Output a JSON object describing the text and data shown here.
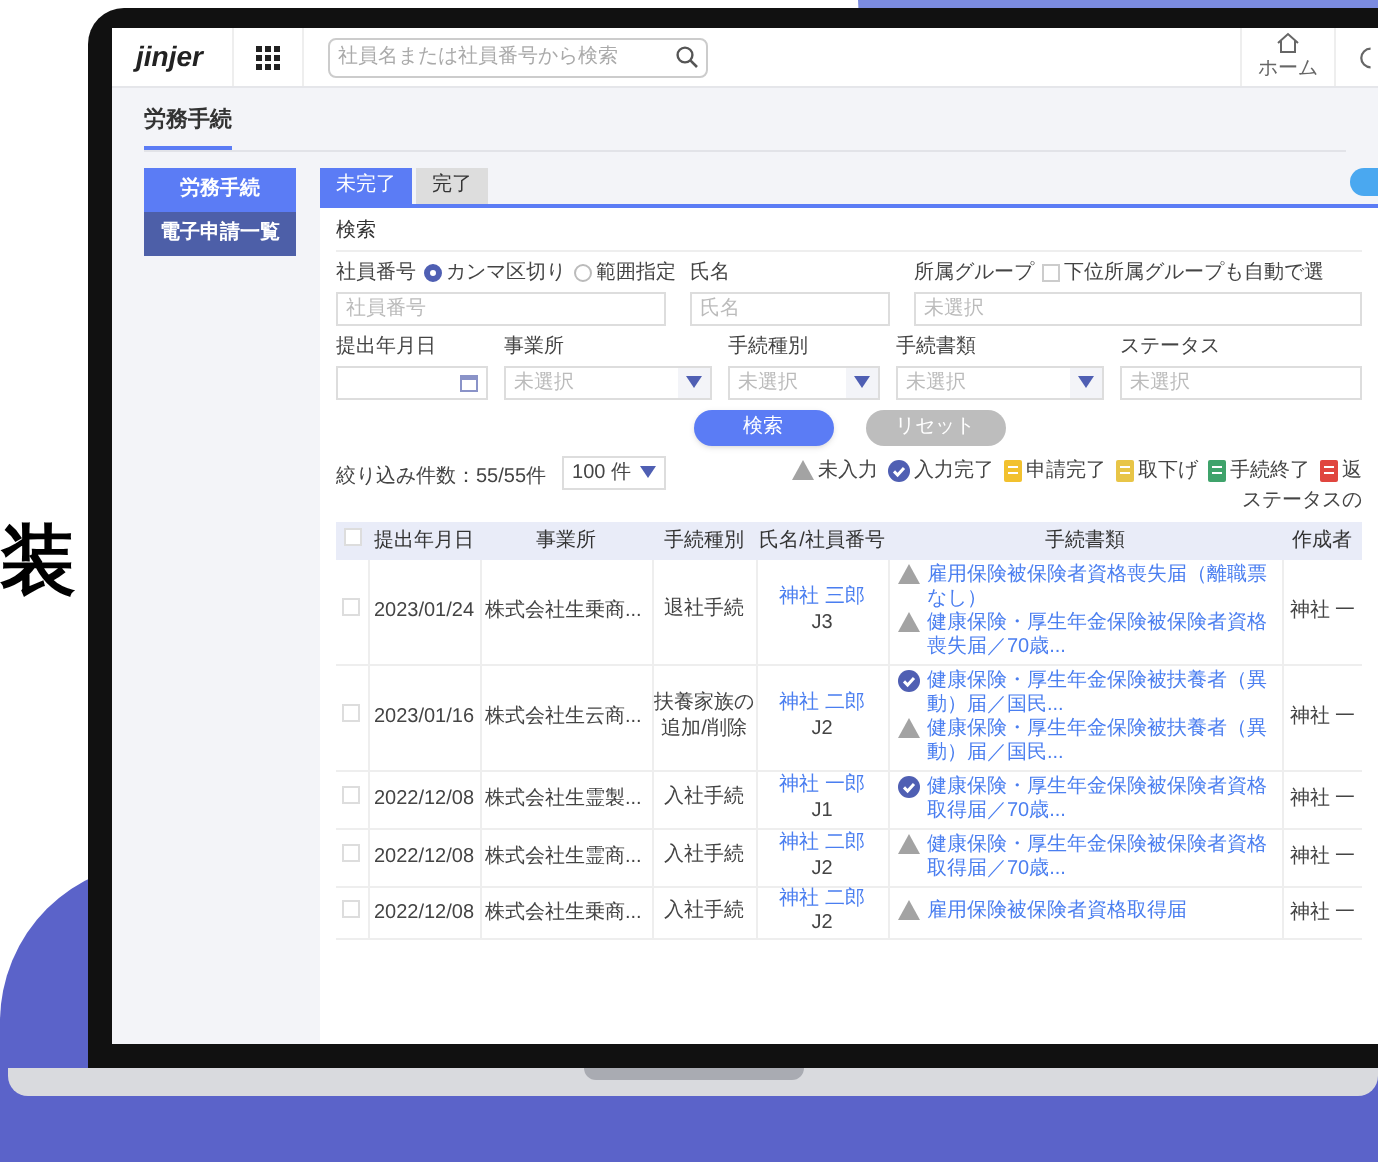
{
  "headline_fragment": "装",
  "header": {
    "logo": "jinjer",
    "search": {
      "placeholder": "社員名または社員番号から検索"
    },
    "nav": [
      {
        "label": "ホーム"
      }
    ]
  },
  "page_title": "労務手続",
  "sidebar": {
    "items": [
      {
        "label": "労務手続",
        "selected": true
      },
      {
        "label": "電子申請一覧",
        "selected": false
      }
    ]
  },
  "tabs": [
    {
      "label": "未完了",
      "selected": true
    },
    {
      "label": "完了",
      "selected": false
    }
  ],
  "search_panel": {
    "title": "検索",
    "employee_number": {
      "label": "社員番号",
      "options": [
        {
          "label": "カンマ区切り",
          "selected": true
        },
        {
          "label": "範囲指定",
          "selected": false
        }
      ],
      "placeholder": "社員番号"
    },
    "name": {
      "label": "氏名",
      "placeholder": "氏名"
    },
    "group": {
      "label": "所属グループ",
      "checkbox": {
        "label": "下位所属グループも自動で選",
        "checked": false
      },
      "placeholder": "未選択"
    },
    "fields": [
      {
        "label": "提出年月日",
        "kind": "date"
      },
      {
        "label": "事業所",
        "kind": "select",
        "placeholder": "未選択"
      },
      {
        "label": "手続種別",
        "kind": "select",
        "placeholder": "未選択"
      },
      {
        "label": "手続書類",
        "kind": "select",
        "placeholder": "未選択"
      },
      {
        "label": "ステータス",
        "kind": "plain",
        "placeholder": "未選択"
      }
    ],
    "buttons": [
      {
        "label": "検索",
        "disabled": false
      },
      {
        "label": "リセット",
        "disabled": true
      }
    ]
  },
  "result_count": "絞り込み件数：55/55件",
  "page_size": "100 件",
  "legend": [
    {
      "label": "未入力",
      "kind": "warning",
      "color": "#a3a3a3"
    },
    {
      "label": "入力完了",
      "kind": "done",
      "color": "#4f5fb3"
    },
    {
      "label": "申請完了",
      "kind": "doc",
      "color": "#f2c12e"
    },
    {
      "label": "取下げ",
      "kind": "doc",
      "color": "#e8c547"
    },
    {
      "label": "手続終了",
      "kind": "doc",
      "color": "#3fa36b"
    },
    {
      "label": "返",
      "kind": "doc",
      "color": "#e0463f"
    }
  ],
  "legend_note": "ステータスの",
  "table": {
    "all_checked": false,
    "columns": [
      "提出年月日",
      "事業所",
      "手続種別",
      "氏名/社員番号",
      "手続書類",
      "作成者"
    ],
    "rows": [
      {
        "checked": false,
        "date": "2023/01/24",
        "office": "株式会社生乗商...",
        "type": "退社手続",
        "name": "神社 三郎",
        "number": "J3",
        "documents": [
          {
            "kind": "warning",
            "title": "雇用保険被保険者資格喪失届（離職票なし）"
          },
          {
            "kind": "warning",
            "title": "健康保険・厚生年金保険被保険者資格喪失届／70歳..."
          }
        ],
        "creator": "神社 一"
      },
      {
        "checked": false,
        "date": "2023/01/16",
        "office": "株式会社生云商...",
        "type": "扶養家族の追加/削除",
        "name": "神社 二郎",
        "number": "J2",
        "documents": [
          {
            "kind": "done",
            "title": "健康保険・厚生年金保険被扶養者（異動）届／国民..."
          },
          {
            "kind": "warning",
            "title": "健康保険・厚生年金保険被扶養者（異動）届／国民..."
          }
        ],
        "creator": "神社 一"
      },
      {
        "checked": false,
        "date": "2022/12/08",
        "office": "株式会社生霊製...",
        "type": "入社手続",
        "name": "神社 一郎",
        "number": "J1",
        "documents": [
          {
            "kind": "done",
            "title": "健康保険・厚生年金保険被保険者資格取得届／70歳..."
          }
        ],
        "creator": "神社 一"
      },
      {
        "checked": false,
        "date": "2022/12/08",
        "office": "株式会社生霊商...",
        "type": "入社手続",
        "name": "神社 二郎",
        "number": "J2",
        "documents": [
          {
            "kind": "warning",
            "title": "健康保険・厚生年金保険被保険者資格取得届／70歳..."
          }
        ],
        "creator": "神社 一"
      },
      {
        "checked": false,
        "date": "2022/12/08",
        "office": "株式会社生乗商...",
        "type": "入社手続",
        "name": "神社 二郎",
        "number": "J2",
        "documents": [
          {
            "kind": "warning",
            "title": "雇用保険被保険者資格取得届"
          }
        ],
        "creator": "神社 一"
      }
    ]
  }
}
